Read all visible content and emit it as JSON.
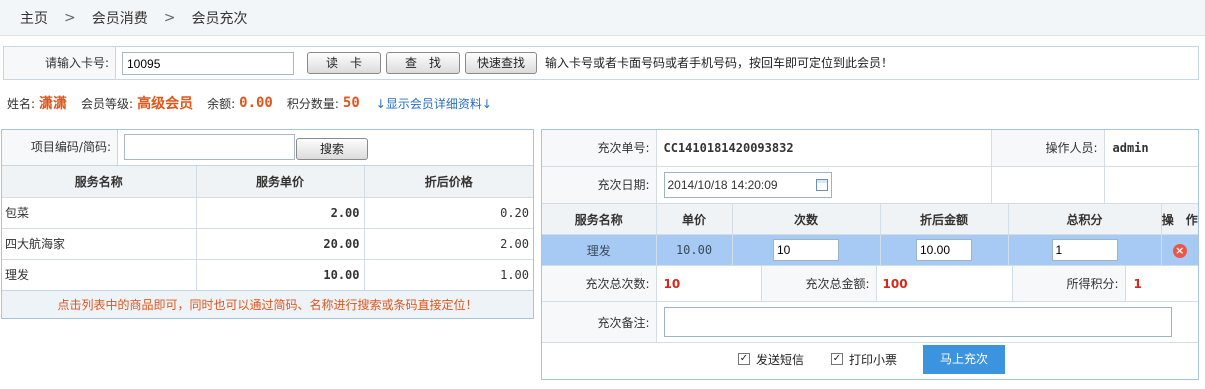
{
  "breadcrumb": {
    "items": [
      "主页",
      "会员消费",
      "会员充次"
    ],
    "separator": ">"
  },
  "cardbar": {
    "label": "请输入卡号:",
    "value": "10095",
    "read_button": "读　卡",
    "find_button": "查　找",
    "quick_find_button": "快速查找",
    "hint": "输入卡号或者卡面号码或者手机号码，按回车即可定位到此会员！"
  },
  "member": {
    "name_label": "姓名:",
    "name": "潇潇",
    "level_label": "会员等级:",
    "level": "高级会员",
    "balance_label": "余额:",
    "balance": "0.00",
    "points_label": "积分数量:",
    "points": "50",
    "detail_link": "↓显示会员详细资料↓"
  },
  "service_search": {
    "label": "项目编码/简码:",
    "value": "",
    "button": "搜索"
  },
  "service_table": {
    "headers": [
      "服务名称",
      "服务单价",
      "折后价格"
    ],
    "rows": [
      {
        "name": "包菜",
        "price": "2.00",
        "discount": "0.20"
      },
      {
        "name": "四大航海家",
        "price": "20.00",
        "discount": "2.00"
      },
      {
        "name": "理发",
        "price": "10.00",
        "discount": "1.00"
      }
    ],
    "tip": "点击列表中的商品即可，同时也可以通过简码、名称进行搜索或条码直接定位！"
  },
  "order": {
    "no_label": "充次单号:",
    "no": "CC1410181420093832",
    "operator_label": "操作人员:",
    "operator": "admin",
    "date_label": "充次日期:",
    "date": "2014/10/18 14:20:09",
    "items_headers": [
      "服务名称",
      "单价",
      "次数",
      "折后金额",
      "总积分",
      "操　作"
    ],
    "items": [
      {
        "name": "理发",
        "price": "10.00",
        "count": "10",
        "amount": "10.00",
        "points": "1"
      }
    ],
    "total_count_label": "充次总次数:",
    "total_count": "10",
    "total_amount_label": "充次总金额:",
    "total_amount": "100",
    "earned_points_label": "所得积分:",
    "earned_points": "1",
    "remark_label": "充次备注:",
    "remark": "",
    "send_sms_label": "发送短信",
    "send_sms_checked": true,
    "print_ticket_label": "打印小票",
    "print_ticket_checked": true,
    "submit_label": "马上充次"
  },
  "colors": {
    "accent_orange": "#e0561a",
    "highlight_red": "#d8261b",
    "selected_row": "#a7caf4",
    "primary_button": "#3c93de",
    "link_blue": "#2a6fc4"
  }
}
